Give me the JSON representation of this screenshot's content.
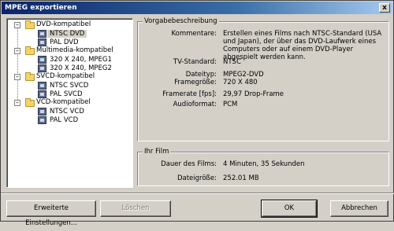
{
  "window": {
    "title": "MPEG exportieren",
    "close_glyph": "x"
  },
  "tree": {
    "groups": [
      {
        "label": "DVD-kompatibel",
        "toggle": "–",
        "items": [
          "NTSC DVD",
          "PAL DVD"
        ]
      },
      {
        "label": "Multimedia-kompatibel",
        "toggle": "–",
        "items": [
          "320 X 240, MPEG1",
          "320 X 240, MPEG2"
        ]
      },
      {
        "label": "SVCD-kompatibel",
        "toggle": "–",
        "items": [
          "NTSC SVCD",
          "PAL SVCD"
        ]
      },
      {
        "label": "VCD-kompatibel",
        "toggle": "–",
        "items": [
          "NTSC VCD",
          "PAL VCD"
        ]
      }
    ],
    "selected": "NTSC DVD"
  },
  "preset": {
    "title": "Vorgabebeschreibung",
    "rows": [
      {
        "label": "Kommentare:",
        "value": "Erstellen eines Films nach NTSC-Standard (USA und Japan), der über das DVD-Laufwerk eines Computers oder auf einem DVD-Player abgespielt werden kann."
      },
      {
        "label": "TV-Standard:",
        "value": "NTSC"
      },
      {
        "label": "Dateityp:",
        "value": "MPEG2-DVD"
      },
      {
        "label": "Framegröße:",
        "value": "720 X 480"
      },
      {
        "label": "Framerate [fps]:",
        "value": "29,97 Drop-Frame"
      },
      {
        "label": "Audioformat:",
        "value": "PCM"
      }
    ]
  },
  "film": {
    "title": "Ihr Film",
    "rows": [
      {
        "label": "Dauer des Films:",
        "value": "4 Minuten, 35 Sekunden"
      },
      {
        "label": "Dateigröße:",
        "value": "252.01 MB"
      }
    ]
  },
  "buttons": {
    "advanced": "Erweiterte Einstellungen...",
    "delete": "Löschen",
    "ok": "OK",
    "cancel": "Abbrechen"
  }
}
